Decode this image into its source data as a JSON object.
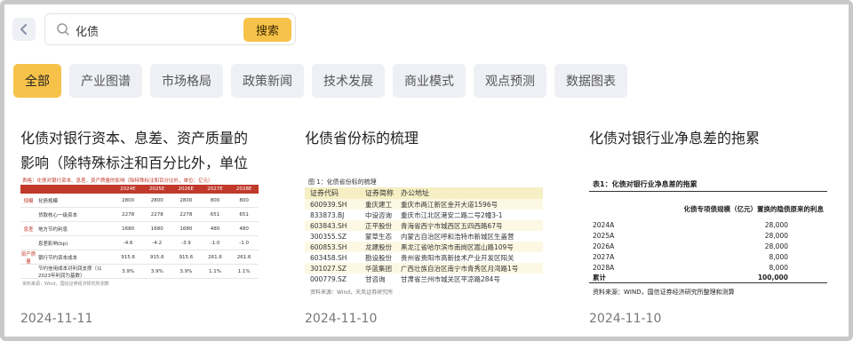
{
  "search": {
    "value": "化债",
    "button_label": "搜索"
  },
  "tabs": [
    {
      "label": "全部",
      "active": true
    },
    {
      "label": "产业图谱",
      "active": false
    },
    {
      "label": "市场格局",
      "active": false
    },
    {
      "label": "政策新闻",
      "active": false
    },
    {
      "label": "技术发展",
      "active": false
    },
    {
      "label": "商业模式",
      "active": false
    },
    {
      "label": "观点预测",
      "active": false
    },
    {
      "label": "数据图表",
      "active": false
    }
  ],
  "cards": [
    {
      "title": "化债对银行资本、息差、资产质量的影响（除特殊标注和百分比外，单位",
      "date": "2024-11-11",
      "thumb": {
        "header": "表格：化债对银行资本、息差、资产质量的影响（除特殊标注和百分比外，单位：亿元）",
        "columns": [
          "",
          "2024E",
          "2025E",
          "2026E",
          "2027E",
          "2028E"
        ],
        "rows": [
          {
            "group": "规模",
            "label": "化债规模",
            "values": [
              "2800",
              "2800",
              "2800",
              "800",
              "800"
            ]
          },
          {
            "group": "",
            "label": "贷款核心一级资本",
            "values": [
              "2278",
              "2278",
              "2278",
              "651",
              "651"
            ]
          },
          {
            "group": "息差",
            "label": "地方节约利息",
            "values": [
              "1680",
              "1680",
              "1680",
              "480",
              "480"
            ]
          },
          {
            "group": "",
            "label": "息差影响(bp)",
            "values": [
              "-4.6",
              "-4.2",
              "-3.9",
              "-1.0",
              "-1.0"
            ]
          },
          {
            "group": "资产质量",
            "label": "银行节约资本成本",
            "values": [
              "915.6",
              "915.6",
              "915.6",
              "261.6",
              "261.6"
            ]
          },
          {
            "group": "",
            "label": "节约信用成本对利润支撑（以2023年利润为基数）",
            "values": [
              "3.9%",
              "3.9%",
              "3.9%",
              "1.1%",
              "1.1%"
            ]
          }
        ],
        "footer": "资料来源：Wind，国信证券经济研究所测算"
      }
    },
    {
      "title": "化债省份标的梳理",
      "date": "2024-11-10",
      "thumb": {
        "title": "图 1：化债省份标的梳理",
        "columns": [
          "证券代码",
          "证券简称",
          "办公地址"
        ],
        "rows": [
          [
            "600939.SH",
            "重庆建工",
            "重庆市两江新区金开大道1596号"
          ],
          [
            "833873.BJ",
            "中设咨询",
            "重庆市江北区港安二路二号2幢3-1"
          ],
          [
            "603843.SH",
            "正平股份",
            "青海省西宁市城西区五四西路67号"
          ],
          [
            "300355.SZ",
            "蒙草生态",
            "内蒙古自治区呼和浩特市新城区生盖营"
          ],
          [
            "600853.SH",
            "龙建股份",
            "黑龙江省哈尔滨市南岗区嵩山路109号"
          ],
          [
            "603458.SH",
            "勘设股份",
            "贵州省贵阳市高新技术产业开发区阳关"
          ],
          [
            "301027.SZ",
            "华蓝集团",
            "广西壮族自治区南宁市青秀区月湾路1号"
          ],
          [
            "000779.SZ",
            "甘咨询",
            "甘肃省兰州市城关区平凉路284号"
          ]
        ],
        "source": "资料来源：Wind，天风证券研究所"
      }
    },
    {
      "title": "化债对银行业净息差的拖累",
      "date": "2024-11-10",
      "thumb": {
        "title": "表1：化债对银行业净息差的拖累",
        "subheader": "化债专项债规模（亿元）置换的隐债原来的利息",
        "rows": [
          {
            "k": "2024A",
            "v": "28,000"
          },
          {
            "k": "2025A",
            "v": "28,000"
          },
          {
            "k": "2026A",
            "v": "28,000"
          },
          {
            "k": "2027A",
            "v": "8,000"
          },
          {
            "k": "2028A",
            "v": "8,000"
          }
        ],
        "total": {
          "k": "累计",
          "v": "100,000"
        },
        "source": "资料来源：WIND，国信证券经济研究所整理和测算"
      }
    }
  ]
}
